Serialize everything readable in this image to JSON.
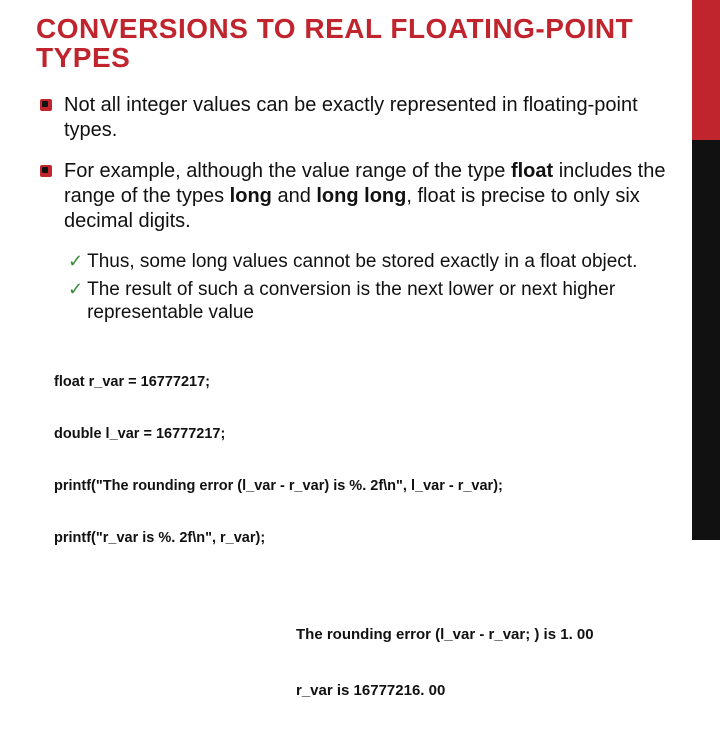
{
  "title": "CONVERSIONS TO REAL FLOATING-POINT TYPES",
  "bullets": {
    "b1": "Not all integer values can be exactly represented in floating-point types.",
    "b2_pre": "For example, although the value range of the type ",
    "b2_float": "float",
    "b2_mid1": " includes the range of the types ",
    "b2_long": "long",
    "b2_mid2": " and ",
    "b2_longlong": "long long",
    "b2_post": ", float is precise to only six decimal digits."
  },
  "subs": {
    "s1": "Thus, some long values cannot be stored exactly in a float object.",
    "s2": "The result of such a conversion is the next lower or next higher representable value"
  },
  "code": {
    "l1": "float r_var = 16777217;",
    "l2": "double l_var = 16777217;",
    "l3": "printf(\"The rounding error (l_var - r_var) is %. 2f\\n\", l_var - r_var);",
    "l4": "printf(\"r_var is %. 2f\\n\", r_var);"
  },
  "output": {
    "o1": "The rounding error (l_var - r_var; ) is 1. 00",
    "o2": "r_var is 16777216. 00"
  }
}
